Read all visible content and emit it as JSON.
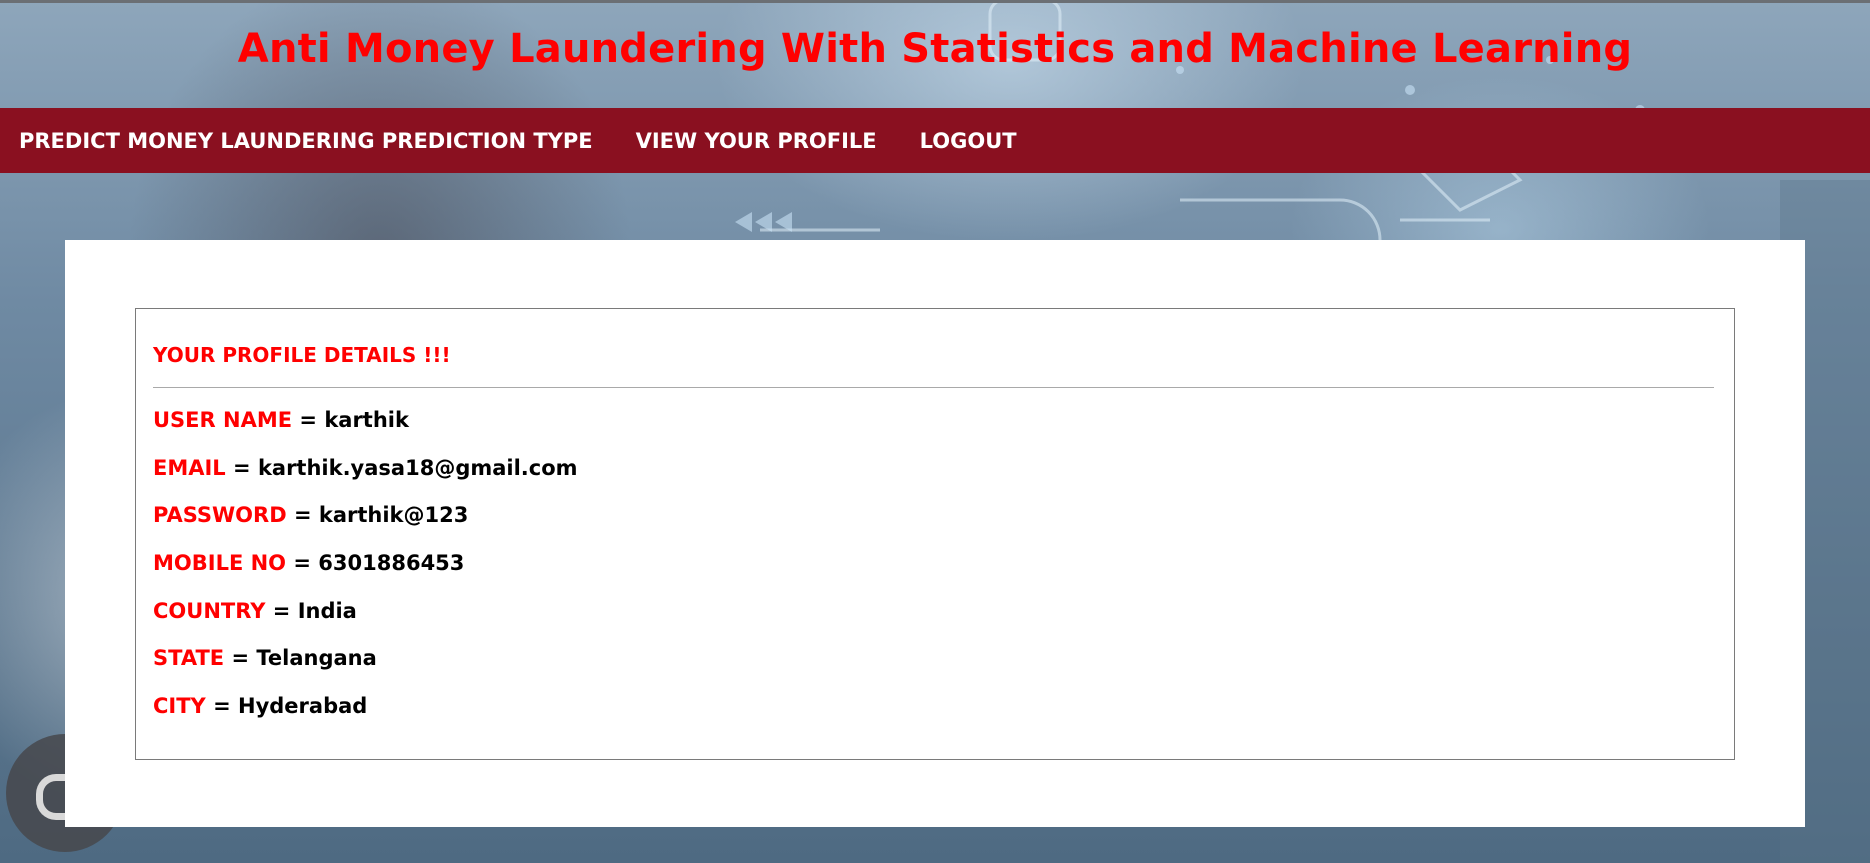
{
  "header": {
    "title": "Anti Money Laundering With Statistics and Machine Learning"
  },
  "nav": {
    "items": [
      {
        "label": "PREDICT MONEY LAUNDERING PREDICTION TYPE"
      },
      {
        "label": "VIEW YOUR PROFILE"
      },
      {
        "label": "LOGOUT"
      }
    ]
  },
  "profile": {
    "heading": "YOUR PROFILE DETAILS !!!",
    "separator": "=",
    "fields": [
      {
        "label": "USER NAME",
        "value": "karthik"
      },
      {
        "label": "EMAIL",
        "value": "karthik.yasa18@gmail.com"
      },
      {
        "label": "PASSWORD",
        "value": "karthik@123"
      },
      {
        "label": "MOBILE NO",
        "value": "6301886453"
      },
      {
        "label": "COUNTRY",
        "value": "India"
      },
      {
        "label": "STATE",
        "value": "Telangana"
      },
      {
        "label": "CITY",
        "value": "Hyderabad"
      }
    ]
  },
  "colors": {
    "title": "#ff0000",
    "navbar": "#8a1020",
    "nav_text": "#ffffff",
    "label": "#ff0000",
    "value": "#000000"
  },
  "icons": {
    "floating_button": "screen-capture-icon"
  }
}
